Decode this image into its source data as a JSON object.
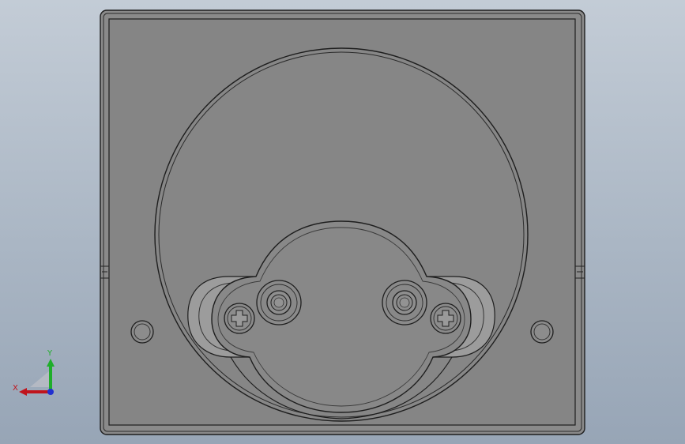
{
  "viewport": {
    "background_top": "#c3ccd6",
    "background_bottom": "#97a5b6",
    "part_face_color": "#858585",
    "edge_color": "#202020"
  },
  "triad": {
    "x_label": "X",
    "y_label": "Y",
    "x_color": "#c0141c",
    "y_color": "#1fae2a",
    "z_color": "#2130d0"
  }
}
